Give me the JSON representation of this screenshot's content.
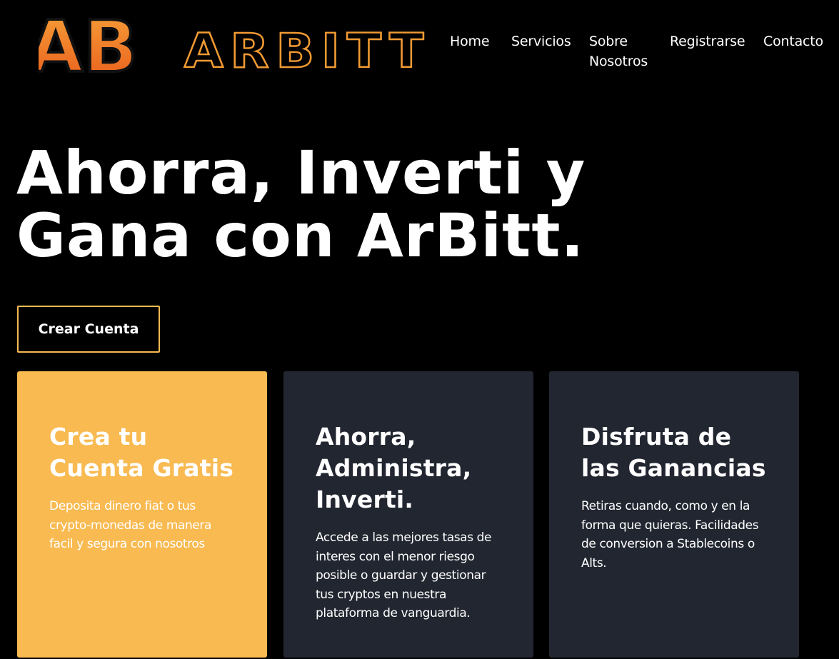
{
  "brand": {
    "logo_monogram": "AB",
    "logo_wordmark": "ARBITT",
    "accent_color": "#f8ba51",
    "logo_gradient": [
      "#f7a33a",
      "#e85a1a"
    ]
  },
  "nav": {
    "items": [
      {
        "label": "Home"
      },
      {
        "label": "Servicios"
      },
      {
        "label": "Sobre Nosotros"
      },
      {
        "label": "Registrarse"
      },
      {
        "label": "Contacto"
      }
    ]
  },
  "hero": {
    "title_line1": "Ahorra, Inverti y",
    "title_line2": "Gana con ArBitt.",
    "cta_label": "Crear Cuenta"
  },
  "cards": [
    {
      "title": "Crea tu Cuenta Gratis",
      "text": "Deposita dinero fiat o tus crypto-monedas de manera facil y segura con nosotros",
      "bg_color": "#f8ba51"
    },
    {
      "title": "Ahorra, Administra, Inverti.",
      "text": "Accede a las mejores tasas de interes con el menor riesgo posible o guardar y gestionar tus cryptos en nuestra plataforma de vanguardia.",
      "bg_color": "#222630"
    },
    {
      "title": "Disfruta de las Ganancias",
      "text": "Retiras cuando, como y en la forma que quieras. Facilidades de conversion a Stablecoins o Alts.",
      "bg_color": "#222630"
    }
  ]
}
